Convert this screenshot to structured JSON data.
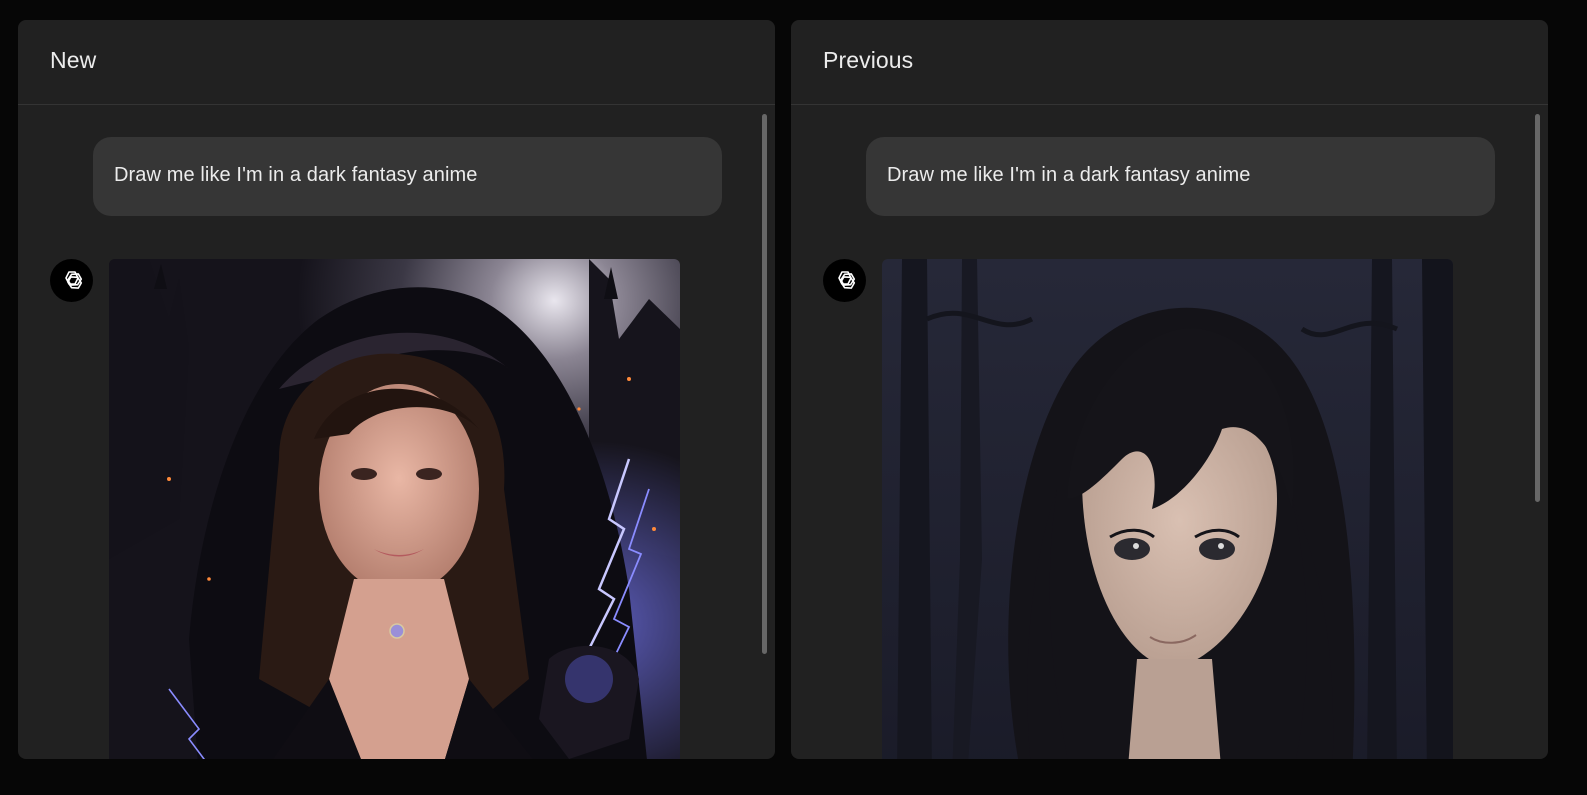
{
  "panels": {
    "new": {
      "title": "New",
      "prompt": "Draw me like I'm in a dark fantasy anime",
      "avatar_icon": "openai-logo-icon",
      "image_subject": "realistic hooded sorceress with violet lightning"
    },
    "previous": {
      "title": "Previous",
      "prompt": "Draw me like I'm in a dark fantasy anime",
      "avatar_icon": "openai-logo-icon",
      "image_subject": "anime-style girl with long black hair in a dark forest"
    }
  },
  "colors": {
    "background": "#060606",
    "panel": "#212121",
    "bubble": "#363636",
    "text": "#ececec",
    "divider": "#343434",
    "lightning": "#8a8cff"
  }
}
